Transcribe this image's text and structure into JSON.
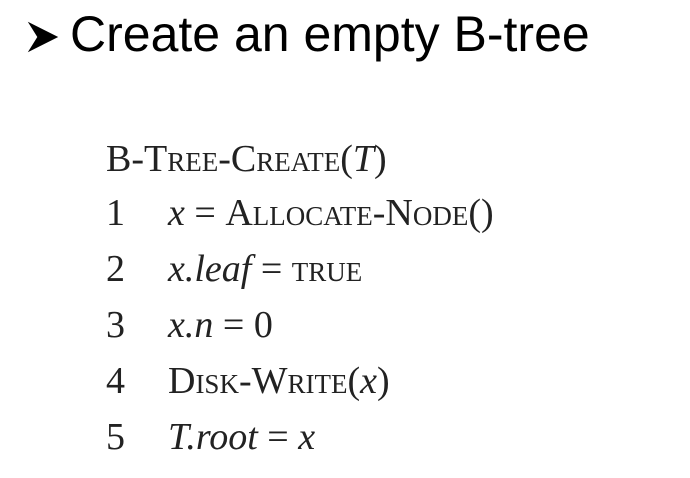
{
  "slide": {
    "title": "Create an empty B-tree",
    "bullet_icon": "arrow-bullet-icon"
  },
  "algorithm": {
    "name": "B-Tree-Create",
    "param": "T",
    "lines": [
      {
        "num": "1",
        "var": "x",
        "eq": " = ",
        "rhs_sc": "Allocate-Node",
        "rhs_tail": "()"
      },
      {
        "num": "2",
        "var": "x.leaf",
        "eq": " = ",
        "rhs_sc": "true"
      },
      {
        "num": "3",
        "var": "x.n",
        "eq": " = ",
        "rhs_plain": "0"
      },
      {
        "num": "4",
        "call_sc": "Disk-Write",
        "open": "(",
        "arg": "x",
        "close": ")"
      },
      {
        "num": "5",
        "var": "T.root",
        "eq": " = ",
        "rhs_var": "x"
      }
    ]
  }
}
